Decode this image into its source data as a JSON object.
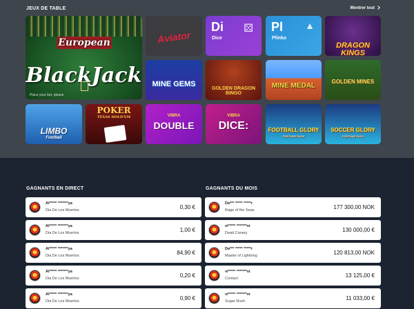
{
  "header": {
    "section_title": "JEUX DE TABLE",
    "show_all": "Montrer tout"
  },
  "games": {
    "blackjack": {
      "line1": "European",
      "line2": "BlackJack",
      "caption": "Place your bet, please"
    },
    "aviator": {
      "title": "Aviator"
    },
    "dice": {
      "code": "Di",
      "name": "Dice",
      "glyph": "⚄"
    },
    "plinko": {
      "code": "Pl",
      "name": "Plinko",
      "glyph": "▲"
    },
    "dragon_kings": {
      "title": "DRAGON KINGS"
    },
    "mine_gems": {
      "title": "MINE GEMS"
    },
    "golden_dragon": {
      "title": "GOLDEN DRAGON BINGO"
    },
    "mine_medal": {
      "title": "MINE MEDAL"
    },
    "golden_mines": {
      "title": "GOLDEN MINES"
    },
    "limbo": {
      "title": "LIMBO",
      "sub": "Football"
    },
    "poker": {
      "title": "POKER",
      "sub": "TEXAS HOLD'EM"
    },
    "vibra_double": {
      "sub": "VIBRA",
      "title": "DOUBLE"
    },
    "vibra_dice": {
      "sub": "VIBRA",
      "title": "DICE:"
    },
    "football_glory": {
      "title": "FOOTBALL GLORY",
      "sub": "FORTUNE PACK"
    },
    "soccer_glory": {
      "title": "SOCCER GLORY",
      "sub": "FORTUNE PACK"
    }
  },
  "live_winners": {
    "title": "GAGNANTS EN DIRECT",
    "rows": [
      {
        "user": "Al***** *******ya",
        "game": "Dia De Los Muertos",
        "amount": "0,30 €"
      },
      {
        "user": "Al***** *******ya",
        "game": "Dia De Los Muertos",
        "amount": "1,00 €"
      },
      {
        "user": "Al***** *******ya",
        "game": "Dia De Los Muertos",
        "amount": "84,90 €"
      },
      {
        "user": "Al***** *******ya",
        "game": "Dia De Los Muertos",
        "amount": "0,20 €"
      },
      {
        "user": "Al***** *******ya",
        "game": "Dia De Los Muertos",
        "amount": "0,90 €"
      }
    ]
  },
  "month_winners": {
    "title": "GAGNANTS DU MOIS",
    "rows": [
      {
        "user": "Da*** ***** *****r",
        "game": "Rage of the Seas",
        "amount": "177 300,00 NOK"
      },
      {
        "user": "vi***** *******st",
        "game": "Dead Canary",
        "amount": "130 000,00 €"
      },
      {
        "user": "Da*** ***** *****r",
        "game": "Master of Lightning",
        "amount": "120 813,00 NOK"
      },
      {
        "user": "vi***** *******st",
        "game": "Contact",
        "amount": "13 125,00 €"
      },
      {
        "user": "vi***** *******st",
        "game": "Sugar Rush",
        "amount": "11 033,00 €"
      }
    ]
  }
}
